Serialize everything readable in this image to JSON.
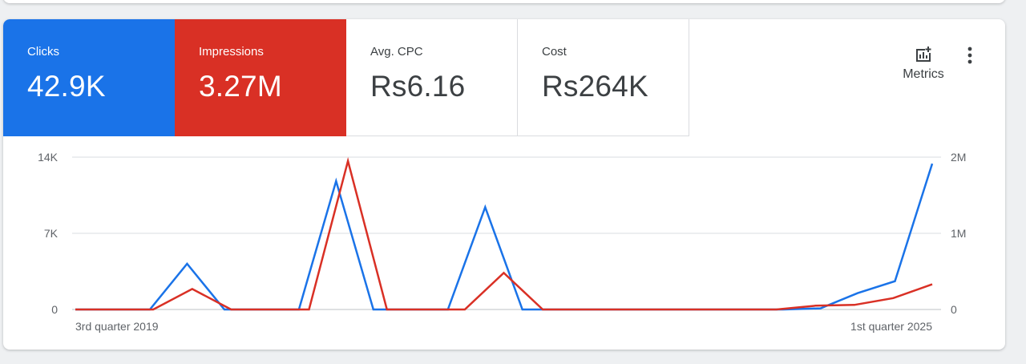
{
  "tiles": {
    "clicks": {
      "label": "Clicks",
      "value": "42.9K",
      "color": "#1a73e8"
    },
    "impressions": {
      "label": "Impressions",
      "value": "3.27M",
      "color": "#d93025"
    },
    "avg_cpc": {
      "label": "Avg. CPC",
      "value": "Rs6.16"
    },
    "cost": {
      "label": "Cost",
      "value": "Rs264K"
    }
  },
  "toolbar": {
    "metrics_label": "Metrics",
    "metrics_icon": "add-chart-icon",
    "more_icon": "more-vert-icon"
  },
  "chart_data": {
    "type": "line",
    "x_labels": [
      "3rd quarter 2019",
      "1st quarter 2025"
    ],
    "left_axis": {
      "ticks": [
        "14K",
        "7K",
        "0"
      ],
      "range": [
        0,
        14000
      ]
    },
    "right_axis": {
      "ticks": [
        "2M",
        "1M",
        "0"
      ],
      "range": [
        0,
        2000000
      ]
    },
    "grid": true,
    "series": [
      {
        "color": "#1a73e8",
        "axis": "left",
        "values": [
          0,
          0,
          0,
          4200,
          0,
          0,
          0,
          11800,
          0,
          0,
          0,
          9400,
          0,
          0,
          0,
          0,
          0,
          0,
          0,
          0,
          100,
          1500,
          2600,
          13400
        ]
      },
      {
        "color": "#d93025",
        "axis": "right",
        "values": [
          0,
          0,
          0,
          270000,
          0,
          0,
          0,
          1950000,
          0,
          0,
          0,
          480000,
          0,
          0,
          0,
          0,
          0,
          0,
          0,
          50000,
          60000,
          150000,
          330000
        ]
      }
    ]
  }
}
